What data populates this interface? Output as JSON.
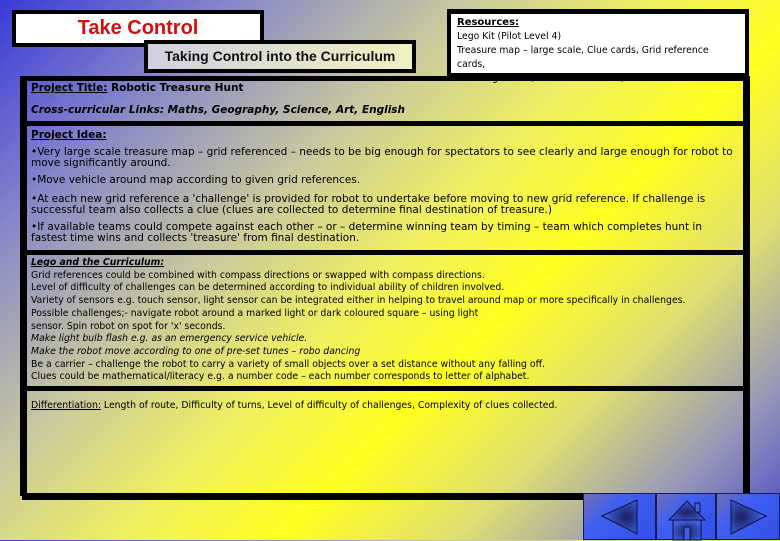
{
  "header": {
    "title": "Take Control",
    "subtitle": "Taking Control into the Curriculum"
  },
  "resources": {
    "heading": "Resources:",
    "lines": [
      "Lego Kit (Pilot Level 4)",
      "Treasure map – large scale, Clue cards, Grid reference cards,",
      "Challenge cards, Piece of 'treasure', Timers"
    ]
  },
  "project": {
    "title_label": "Project Title:",
    "title_value": " Robotic Treasure Hunt",
    "links_label": "Cross-curricular Links:",
    "links_value": " Maths, Geography, Science, Art, English"
  },
  "idea": {
    "heading": "Project Idea:",
    "bullets": [
      "•Very large scale treasure map – grid referenced – needs to be big enough for spectators to see clearly and large enough for robot to move significantly around.",
      "•Move vehicle around map according to given grid references.",
      "•At each new grid reference a 'challenge' is provided for robot to undertake before moving to new grid reference.  If challenge is successful team also collects a clue (clues are collected to determine final destination of treasure.)",
      "•If available teams could compete against each other – or – determine winning team by timing – team which completes hunt in fastest time wins and collects 'treasure' from final destination."
    ]
  },
  "curriculum": {
    "heading": "Lego and the Curriculum:",
    "lines": [
      "Grid references could be combined with compass directions or swapped with compass directions.",
      "Level of difficulty of challenges can be determined  according to individual ability of children involved.",
      "Variety of sensors e.g. touch sensor, light sensor can be integrated either in helping to travel around map or more specifically in challenges.",
      "Possible challenges;- navigate robot around a marked light or dark coloured square – using light",
      "sensor. Spin robot on spot for 'x' seconds.",
      "Make light bulb flash e.g. as an emergency service vehicle.",
      "Make the robot move according to one of pre-set tunes – robo dancing",
      "Be a carrier – challenge the robot to carry a variety of small objects over a set distance without any falling off.",
      "Clues could be mathematical/literacy e.g. a number code – each number corresponds to letter of alphabet."
    ]
  },
  "differentiation": {
    "label": "Differentiation:",
    "value": "  Length of route, Difficulty of turns, Level of difficulty of challenges, Complexity of clues collected."
  },
  "nav": {
    "back_icon": "triangle-left",
    "home_icon": "house",
    "forward_icon": "triangle-right"
  }
}
